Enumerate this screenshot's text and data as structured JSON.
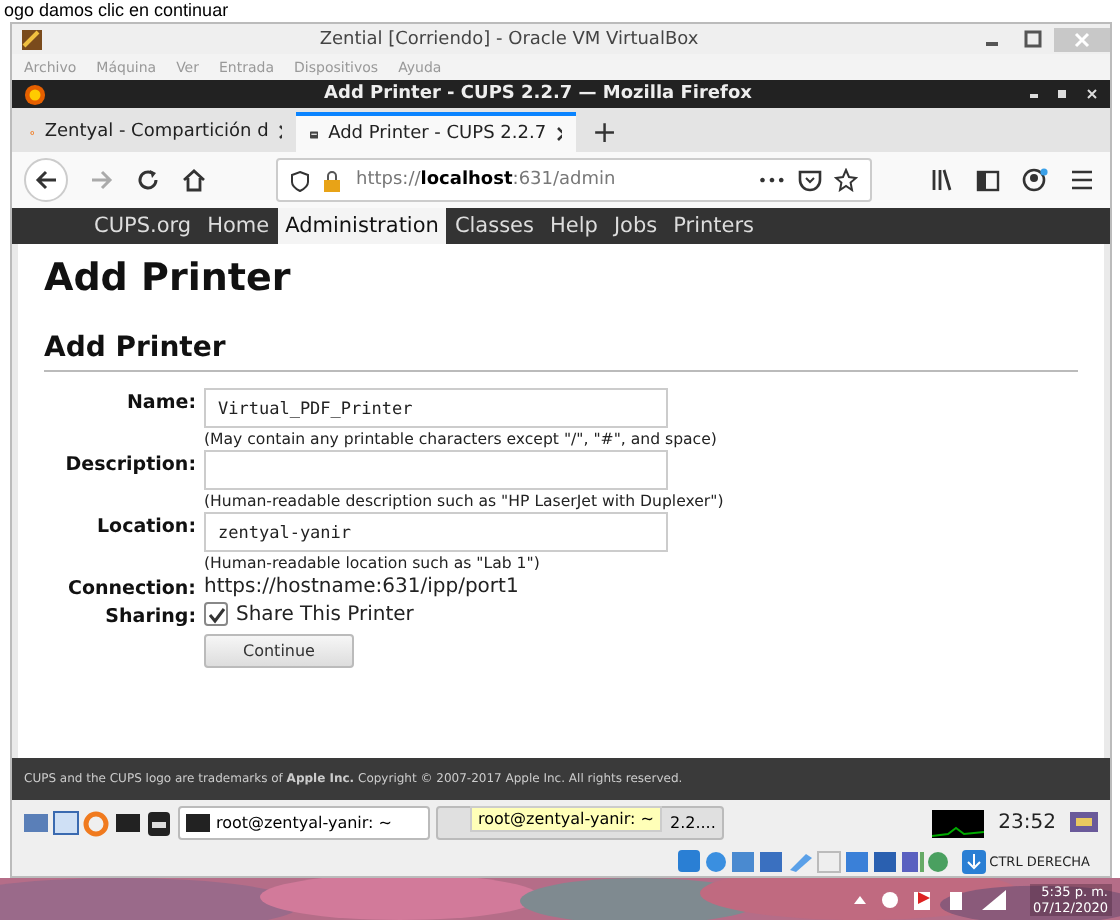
{
  "caption": "ogo damos clic en continuar",
  "vbox": {
    "title": "Zential [Corriendo] - Oracle VM VirtualBox",
    "menu": [
      "Archivo",
      "Máquina",
      "Ver",
      "Entrada",
      "Dispositivos",
      "Ayuda"
    ]
  },
  "firefox": {
    "title": "Add Printer - CUPS 2.2.7 — Mozilla Firefox",
    "tabs": [
      {
        "label": "Zentyal - Compartición d",
        "selected": false
      },
      {
        "label": "Add Printer - CUPS 2.2.7",
        "selected": true
      }
    ],
    "new_tab": "+",
    "url": {
      "scheme": "https://",
      "host": "localhost",
      "rest": ":631/admin"
    },
    "more": "•••"
  },
  "cups_nav": [
    {
      "label": "CUPS.org",
      "selected": false
    },
    {
      "label": "Home",
      "selected": false
    },
    {
      "label": "Administration",
      "selected": true
    },
    {
      "label": "Classes",
      "selected": false
    },
    {
      "label": "Help",
      "selected": false
    },
    {
      "label": "Jobs",
      "selected": false
    },
    {
      "label": "Printers",
      "selected": false
    }
  ],
  "page": {
    "heading": "Add Printer",
    "section": "Add Printer",
    "fields": [
      {
        "kind": "input",
        "label": "Name:",
        "value": "Virtual_PDF_Printer",
        "hint": "(May contain any printable characters except \"/\", \"#\", and space)"
      },
      {
        "kind": "input",
        "label": "Description:",
        "hint": "(Human-readable description such as \"HP LaserJet with Duplexer\")"
      },
      {
        "kind": "input",
        "label": "Location:",
        "value": "zentyal-yanir",
        "hint": "(Human-readable location such as \"Lab 1\")"
      },
      {
        "kind": "text",
        "label": "Connection:",
        "value": "https://hostname:631/ipp/port1"
      },
      {
        "kind": "checkbox",
        "label": "Sharing:",
        "text": "Share This Printer",
        "checked": true
      }
    ],
    "button": "Continue"
  },
  "footer": "CUPS and the CUPS logo are trademarks of **Apple Inc.** Copyright © 2007-2017 Apple Inc. All rights reserved.",
  "guest_taskbar": {
    "tasks": [
      {
        "label": "root@zentyal-yanir: ~"
      },
      {
        "label": "2.2...."
      }
    ],
    "tooltip": "root@zentyal-yanir: ~",
    "clock": "23:52",
    "host_key": "CTRL DERECHA"
  },
  "host_tray": {
    "time": "5:35 p. m.",
    "date": "07/12/2020"
  }
}
